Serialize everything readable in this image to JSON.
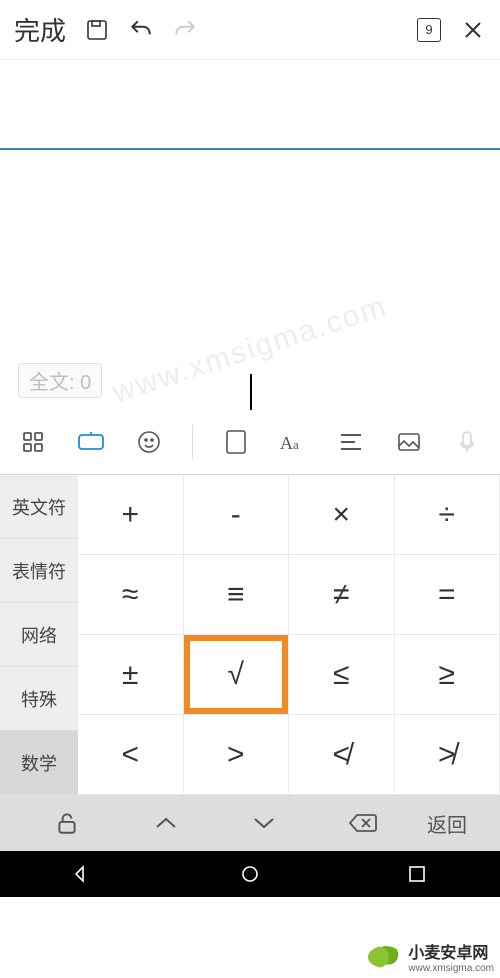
{
  "topbar": {
    "done_label": "完成",
    "page_number": "9"
  },
  "doc": {
    "char_count_label": "全文: 0"
  },
  "categories": [
    {
      "label": "英文符",
      "active": false
    },
    {
      "label": "表情符",
      "active": false
    },
    {
      "label": "网络",
      "active": false
    },
    {
      "label": "特殊",
      "active": false
    },
    {
      "label": "数学",
      "active": true
    }
  ],
  "grid": [
    [
      "+",
      "-",
      "×",
      "÷"
    ],
    [
      "≈",
      "≡",
      "≠",
      "="
    ],
    [
      "±",
      "√",
      "≤",
      "≥"
    ],
    [
      "<",
      ">",
      "≮",
      "≯"
    ]
  ],
  "grid_highlight": {
    "row": 2,
    "col": 1
  },
  "kb": {
    "return_label": "返回"
  },
  "watermark": "www.xmsigma.com",
  "brand": {
    "name": "小麦安卓网",
    "url": "www.xmsigma.com"
  }
}
